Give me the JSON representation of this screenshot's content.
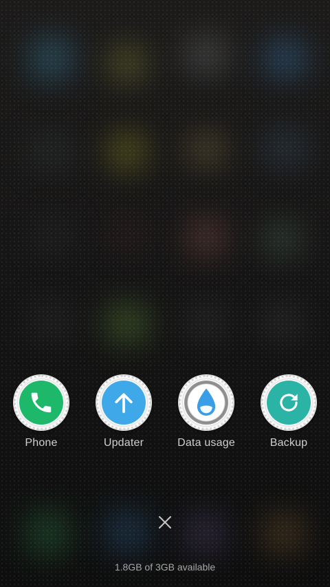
{
  "recent_apps": [
    {
      "label": "Phone",
      "icon": "phone-icon",
      "color": "#1db86a"
    },
    {
      "label": "Updater",
      "icon": "arrow-up-icon",
      "color": "#3fa8e8"
    },
    {
      "label": "Data usage",
      "icon": "water-drop-icon",
      "color": "#3a9ee6"
    },
    {
      "label": "Backup",
      "icon": "refresh-icon",
      "color": "#2bb3a5"
    }
  ],
  "close_button": {
    "icon": "close-icon"
  },
  "memory_status": "1.8GB of 3GB available"
}
